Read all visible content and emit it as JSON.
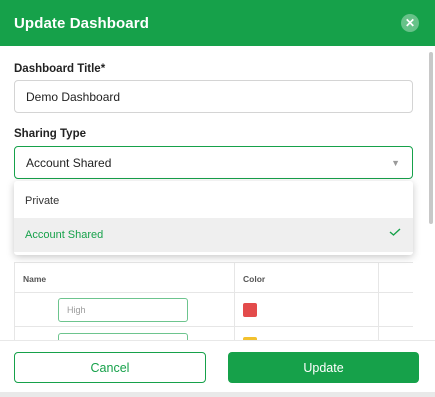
{
  "header": {
    "title": "Update Dashboard",
    "close_icon": "close-icon"
  },
  "form": {
    "title_label": "Dashboard Title*",
    "title_value": "Demo Dashboard",
    "sharing_label": "Sharing Type",
    "sharing_value": "Account Shared",
    "sharing_options": [
      {
        "label": "Private",
        "selected": false
      },
      {
        "label": "Account Shared",
        "selected": true
      }
    ]
  },
  "table": {
    "headers": {
      "name": "Name",
      "color": "Color"
    },
    "rows": [
      {
        "placeholder": "High",
        "color": "#e34b4b"
      },
      {
        "placeholder": "",
        "color": "#f2c12e"
      }
    ]
  },
  "footer": {
    "cancel_label": "Cancel",
    "update_label": "Update"
  },
  "colors": {
    "accent": "#16a14a"
  }
}
